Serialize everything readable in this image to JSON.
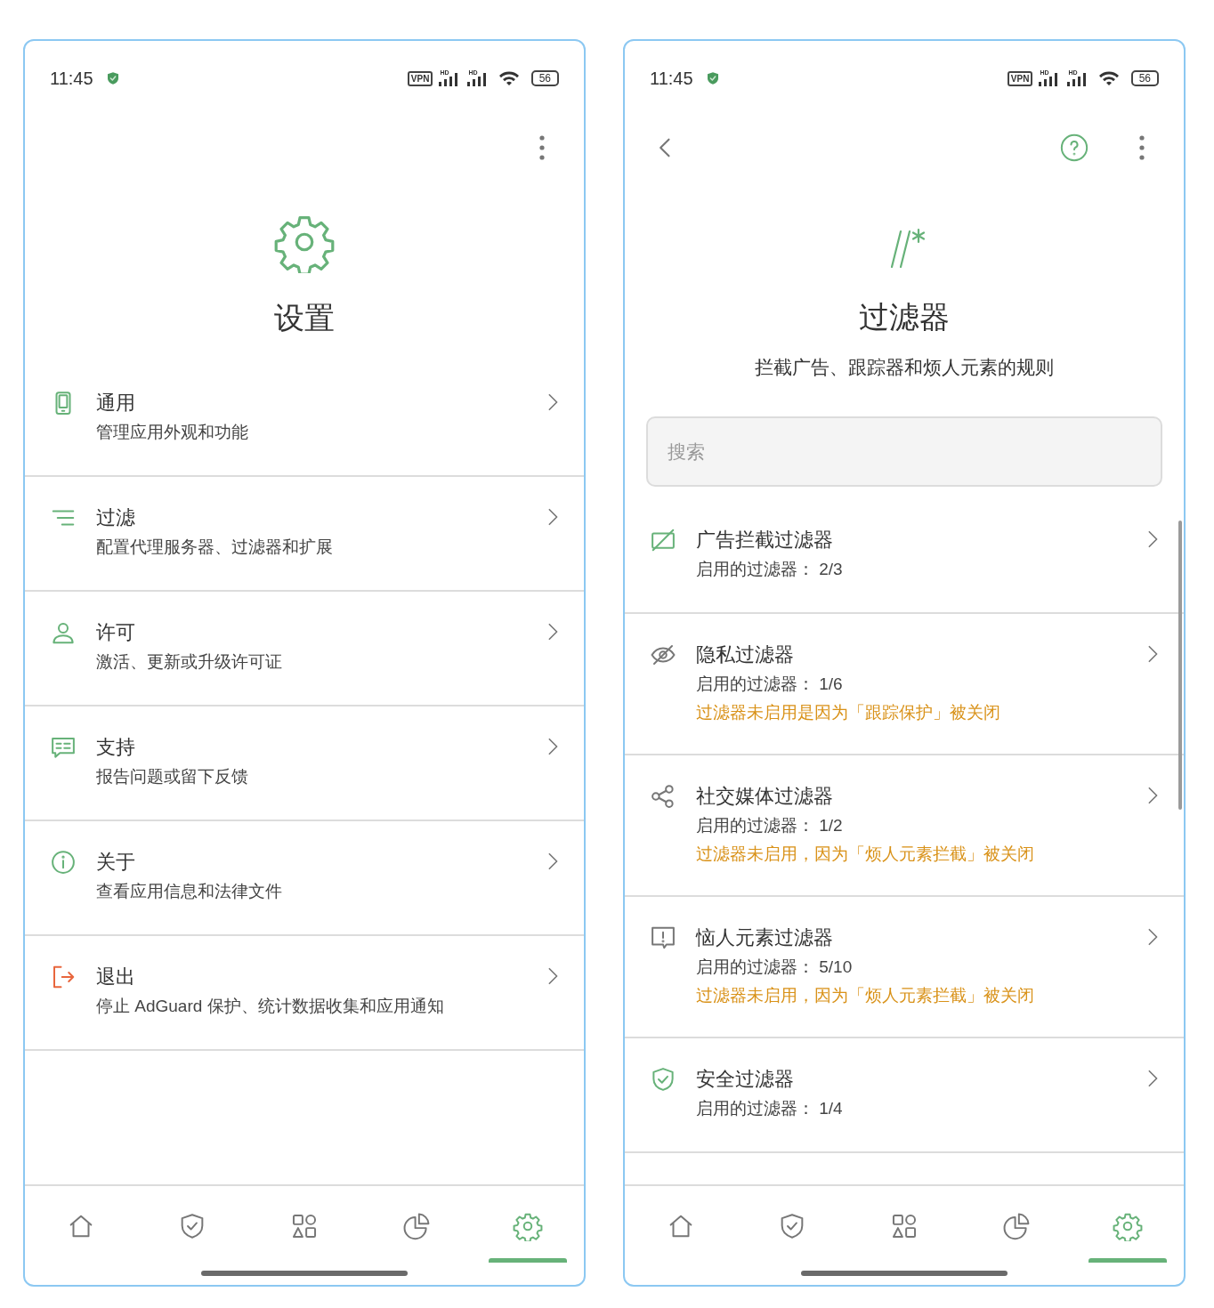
{
  "screens": [
    {
      "status_bar": {
        "time": "11:45",
        "vpn": "VPN",
        "network_1": "HD",
        "network_2": "HD",
        "battery": "56"
      },
      "header": {
        "title": "设置"
      },
      "items": [
        {
          "title": "通用",
          "subtitle": "管理应用外观和功能",
          "color": "#67b279"
        },
        {
          "title": "过滤",
          "subtitle": "配置代理服务器、过滤器和扩展",
          "color": "#67b279"
        },
        {
          "title": "许可",
          "subtitle": "激活、更新或升级许可证",
          "color": "#67b279"
        },
        {
          "title": "支持",
          "subtitle": "报告问题或留下反馈",
          "color": "#67b279"
        },
        {
          "title": "关于",
          "subtitle": "查看应用信息和法律文件",
          "color": "#67b279"
        },
        {
          "title": "退出",
          "subtitle": "停止 AdGuard 保护、统计数据收集和应用通知",
          "color": "#e8663d"
        }
      ],
      "nav": [
        {
          "selected": false
        },
        {
          "selected": false
        },
        {
          "selected": false
        },
        {
          "selected": false
        },
        {
          "selected": true
        }
      ]
    },
    {
      "status_bar": {
        "time": "11:45",
        "vpn": "VPN",
        "network_1": "HD",
        "network_2": "HD",
        "battery": "56"
      },
      "top_bar": {
        "back": true,
        "help": true
      },
      "header": {
        "title": "过滤器",
        "subtitle": "拦截广告、跟踪器和烦人元素的规则"
      },
      "search": {
        "placeholder": "搜索"
      },
      "filters": [
        {
          "title": "广告拦截过滤器",
          "subtitle": "启用的过滤器：  2/3",
          "enabled": true
        },
        {
          "title": "隐私过滤器",
          "subtitle": "启用的过滤器：  1/6",
          "warning": "过滤器未启用是因为「跟踪保护」被关闭",
          "enabled": false
        },
        {
          "title": "社交媒体过滤器",
          "subtitle": "启用的过滤器：  1/2",
          "warning": "过滤器未启用，因为「烦人元素拦截」被关闭",
          "enabled": false
        },
        {
          "title": "恼人元素过滤器",
          "subtitle": "启用的过滤器：  5/10",
          "warning": "过滤器未启用，因为「烦人元素拦截」被关闭",
          "enabled": false
        },
        {
          "title": "安全过滤器",
          "subtitle": "启用的过滤器：  1/4",
          "enabled": true
        }
      ],
      "nav": [
        {
          "selected": false
        },
        {
          "selected": false
        },
        {
          "selected": false
        },
        {
          "selected": false
        },
        {
          "selected": true
        }
      ]
    }
  ]
}
